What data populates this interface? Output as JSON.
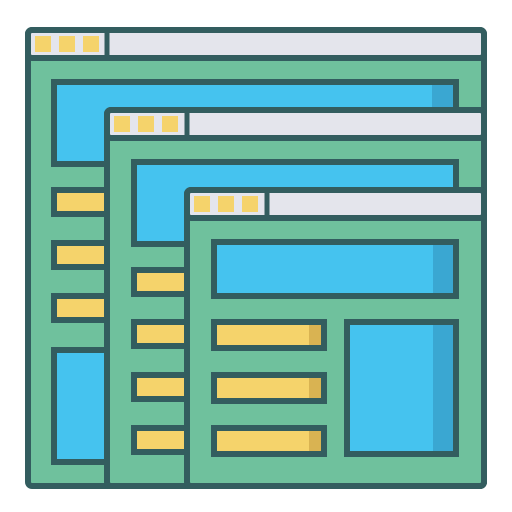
{
  "icon": {
    "name": "multiple-browser-windows-icon",
    "window_count": 3
  },
  "colors": {
    "outline": "#335d5f",
    "window_body": "#6fc19d",
    "window_body_shadow": "#5aa989",
    "title_bar": "#e4e5ec",
    "title_bar_dots": "#f5d36b",
    "banner": "#45c3ef",
    "banner_shadow": "#3aa7d2",
    "text_line": "#f5d36b",
    "text_line_shadow": "#d9b352",
    "image_block": "#45c3ef"
  }
}
